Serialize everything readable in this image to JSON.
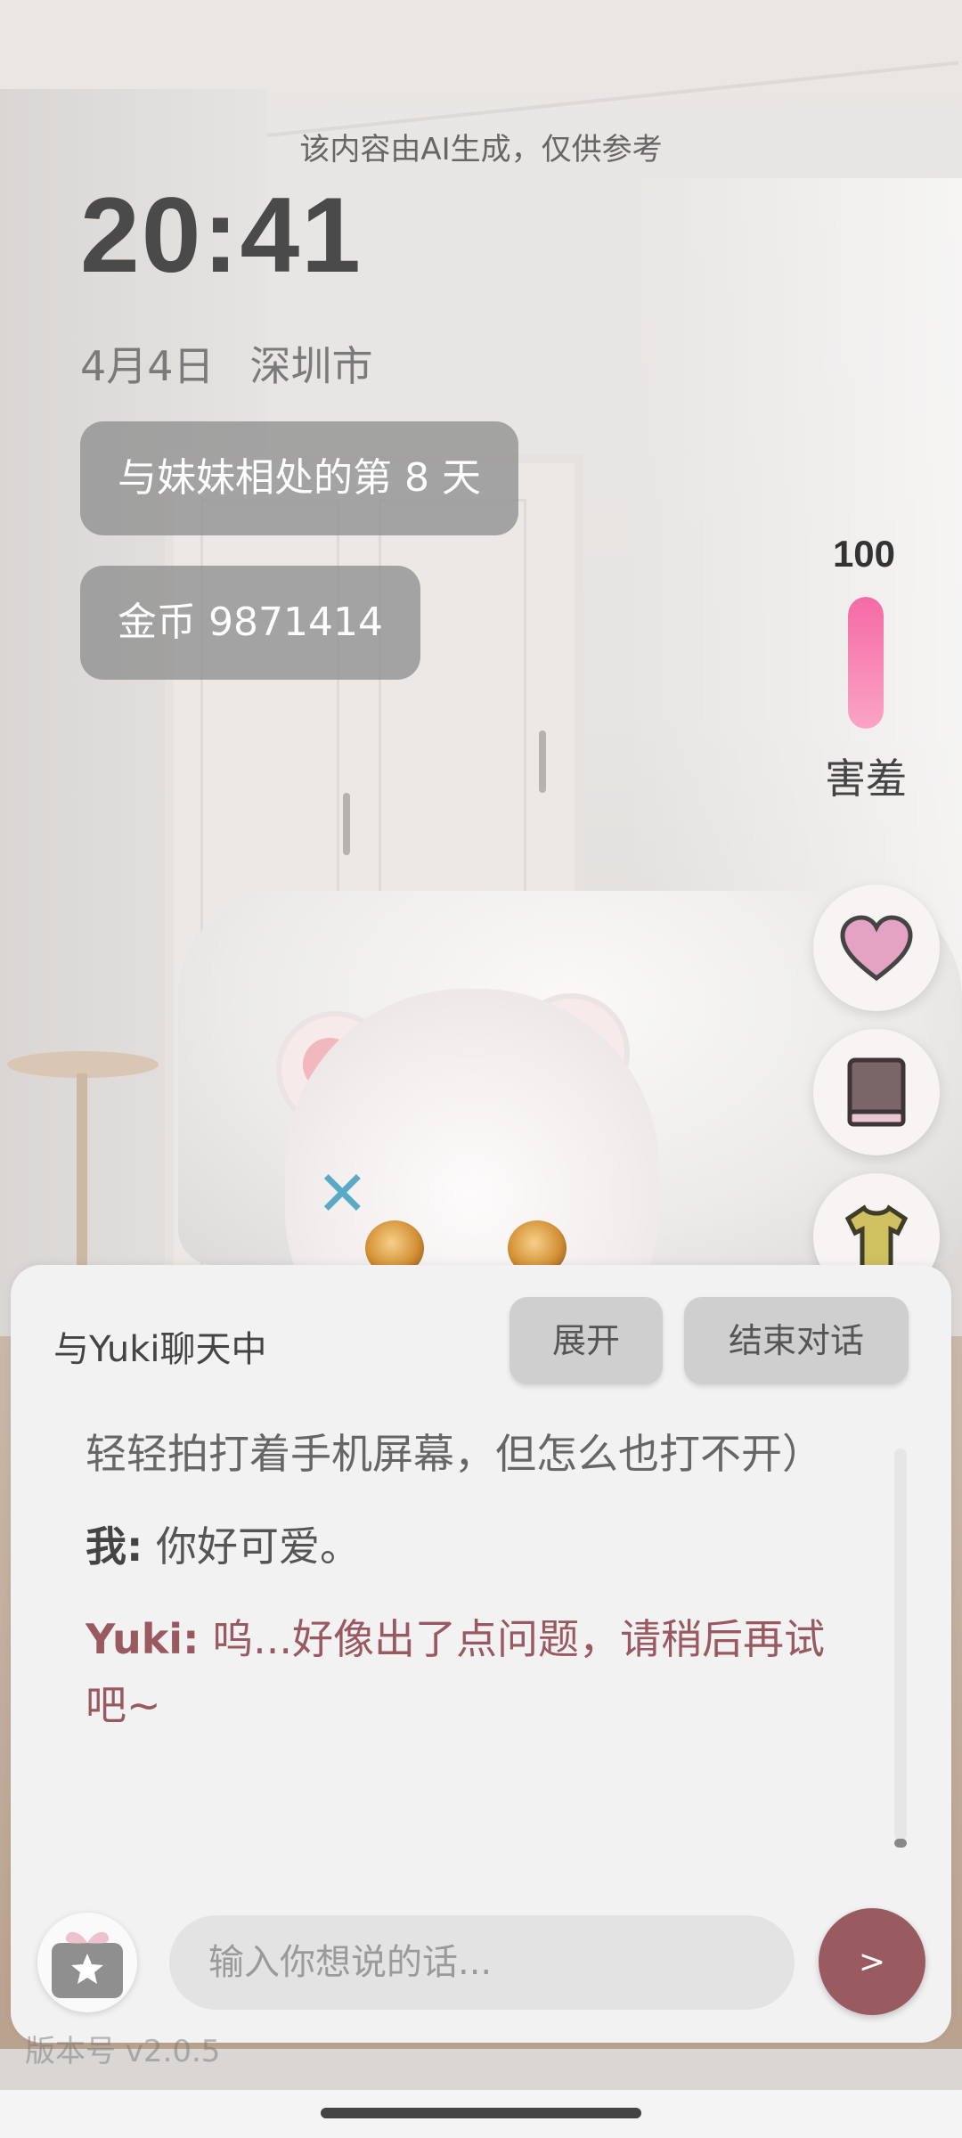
{
  "notice": "该内容由AI生成，仅供参考",
  "clock": "20:41",
  "date": "4月4日",
  "city": "深圳市",
  "days_pill": "与妹妹相处的第 8 天",
  "coins_pill": "金币 9871414",
  "mood": {
    "value": "100",
    "label": "害羞",
    "level_percent": 100,
    "color": "#f46aa5"
  },
  "side_buttons": [
    {
      "name": "heart",
      "icon": "heart-icon"
    },
    {
      "name": "book",
      "icon": "book-icon"
    },
    {
      "name": "outfit",
      "icon": "shirt-icon"
    }
  ],
  "chat": {
    "title": "与Yuki聊天中",
    "expand_label": "展开",
    "end_label": "结束对话",
    "messages": {
      "partial": "轻轻拍打着手机屏幕，但怎么也打不开）",
      "me_speaker": "我:",
      "me_text": " 你好可爱。",
      "yuki_speaker": "Yuki:",
      "yuki_text": " 呜...好像出了点问题，请稍后再试吧~"
    },
    "input_placeholder": "输入你想说的话...",
    "send_label": ">"
  },
  "version_label": "版本号 v2.0.5",
  "colors": {
    "accent": "#9a5b60",
    "yuki_text": "#9a5860",
    "pill_bg": "#8c8c8c"
  }
}
